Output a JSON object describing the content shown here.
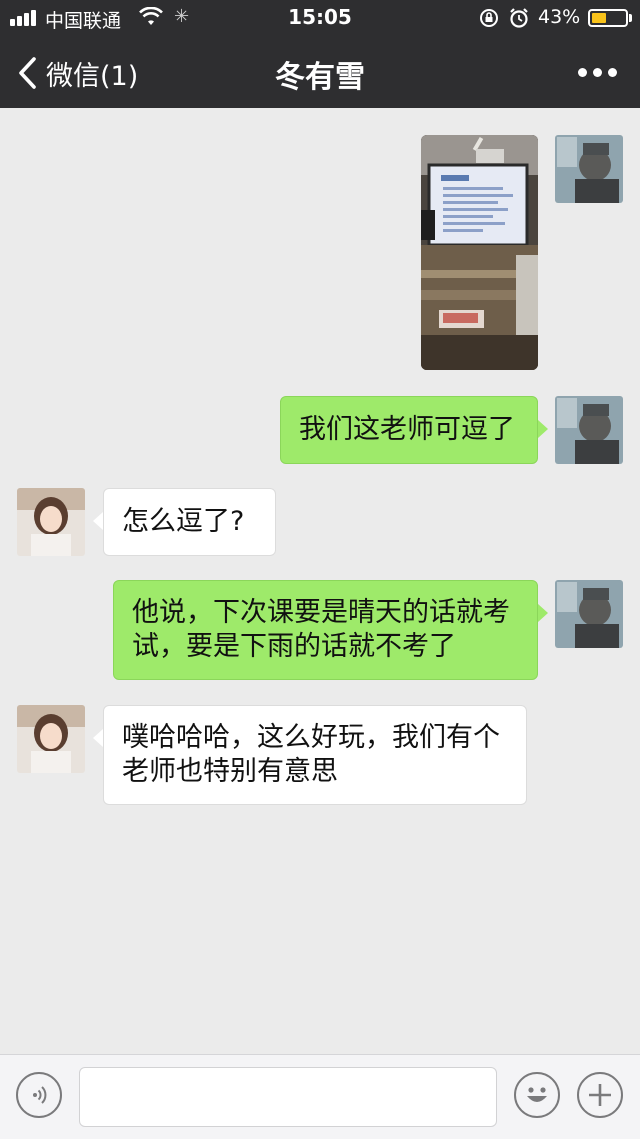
{
  "status_bar": {
    "carrier": "中国联通",
    "time": "15:05",
    "battery_percent": "43%",
    "battery_level": 0.43,
    "battery_color": "#f9c31b",
    "icons": [
      "signal-icon",
      "wifi-icon",
      "activity-icon",
      "orientation-lock-icon",
      "alarm-icon",
      "battery-icon"
    ]
  },
  "nav": {
    "back_label": "微信(1)",
    "title": "冬有雪",
    "icons": [
      "back-chevron-icon",
      "more-icon"
    ]
  },
  "messages": [
    {
      "sender": "self",
      "type": "image"
    },
    {
      "sender": "self",
      "type": "text",
      "lines": [
        "我们这老师可逗了"
      ]
    },
    {
      "sender": "contact",
      "type": "text",
      "lines": [
        "怎么逗了?"
      ]
    },
    {
      "sender": "self",
      "type": "text",
      "lines": [
        "他说，下次课要是晴天的话就考",
        "试，要是下雨的话就不考了"
      ]
    },
    {
      "sender": "contact",
      "type": "text",
      "lines": [
        "噗哈哈哈，这么好玩，我们有个",
        "老师也特别有意思"
      ]
    }
  ],
  "input_bar": {
    "text": "",
    "icons": [
      "voice-icon",
      "emoji-icon",
      "add-icon"
    ]
  },
  "colors": {
    "header_bg": "#2e2e30",
    "chat_bg": "#ebebeb",
    "self_bubble": "#9eea6a",
    "contact_bubble": "#ffffff"
  }
}
